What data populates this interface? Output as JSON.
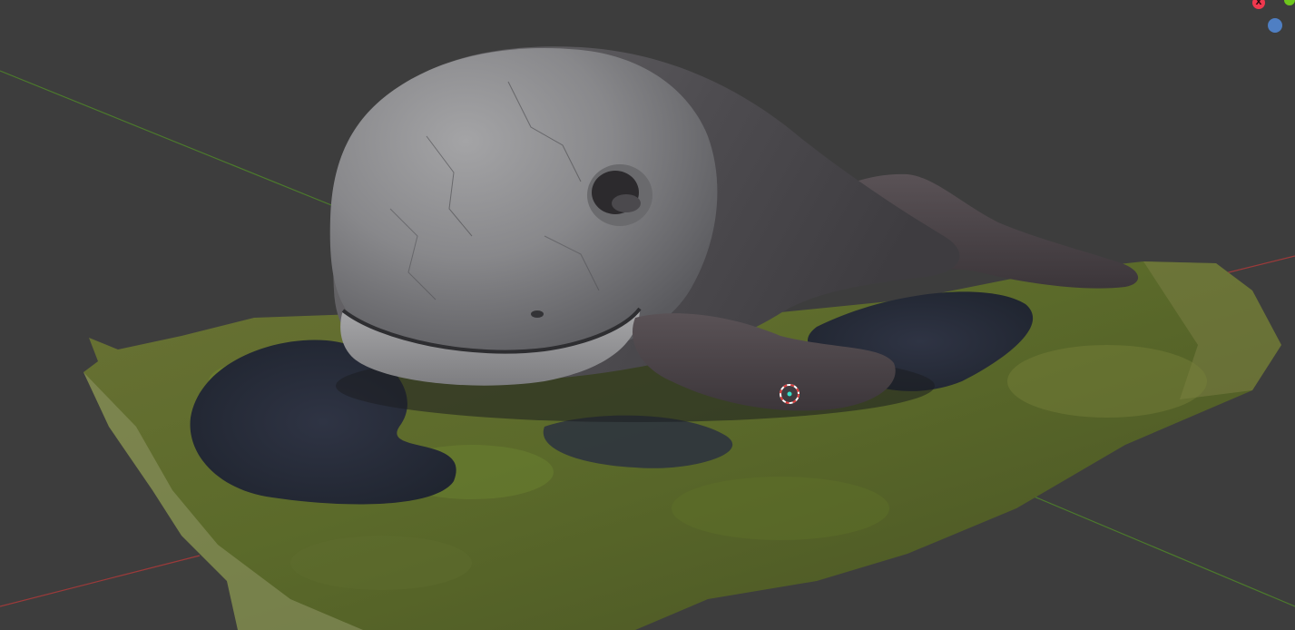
{
  "viewport": {
    "background": "#3d3d3d",
    "floor_axis_colors": {
      "x": "#9b3a3a",
      "y": "#4c7a2c"
    }
  },
  "gizmo": {
    "x_label": "X",
    "colors": {
      "x": "#f0384e",
      "y": "#6ec71c",
      "z": "#4f7fc3"
    }
  },
  "scene": {
    "object": "whale-statue-scan",
    "ground": "grass-and-gravel-patch"
  },
  "cursor_3d": {
    "icon": "3d-cursor-icon",
    "colors": [
      "#d93a3a",
      "#ffffff"
    ]
  }
}
